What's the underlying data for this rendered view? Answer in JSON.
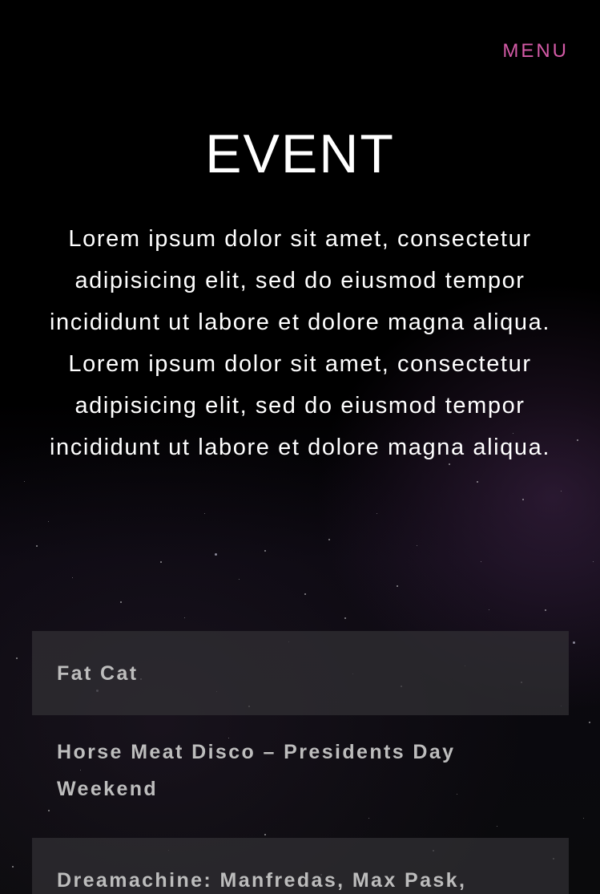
{
  "header": {
    "menu_label": "MENU",
    "accent_color": "#d35aa6"
  },
  "intro": {
    "title": "EVENT",
    "text": "Lorem ipsum dolor sit amet, consectetur adipisicing elit, sed do eiusmod tempor incididunt ut labore et dolore magna aliqua. Lorem ipsum dolor sit amet, consectetur adipisicing elit, sed do eiusmod tempor incididunt ut labore et dolore magna aliqua."
  },
  "events": [
    {
      "name": "Fat Cat"
    },
    {
      "name": "Horse Meat Disco – Presidents Day Weekend"
    },
    {
      "name": "Dreamachine: Manfredas, Max Pask,"
    }
  ]
}
